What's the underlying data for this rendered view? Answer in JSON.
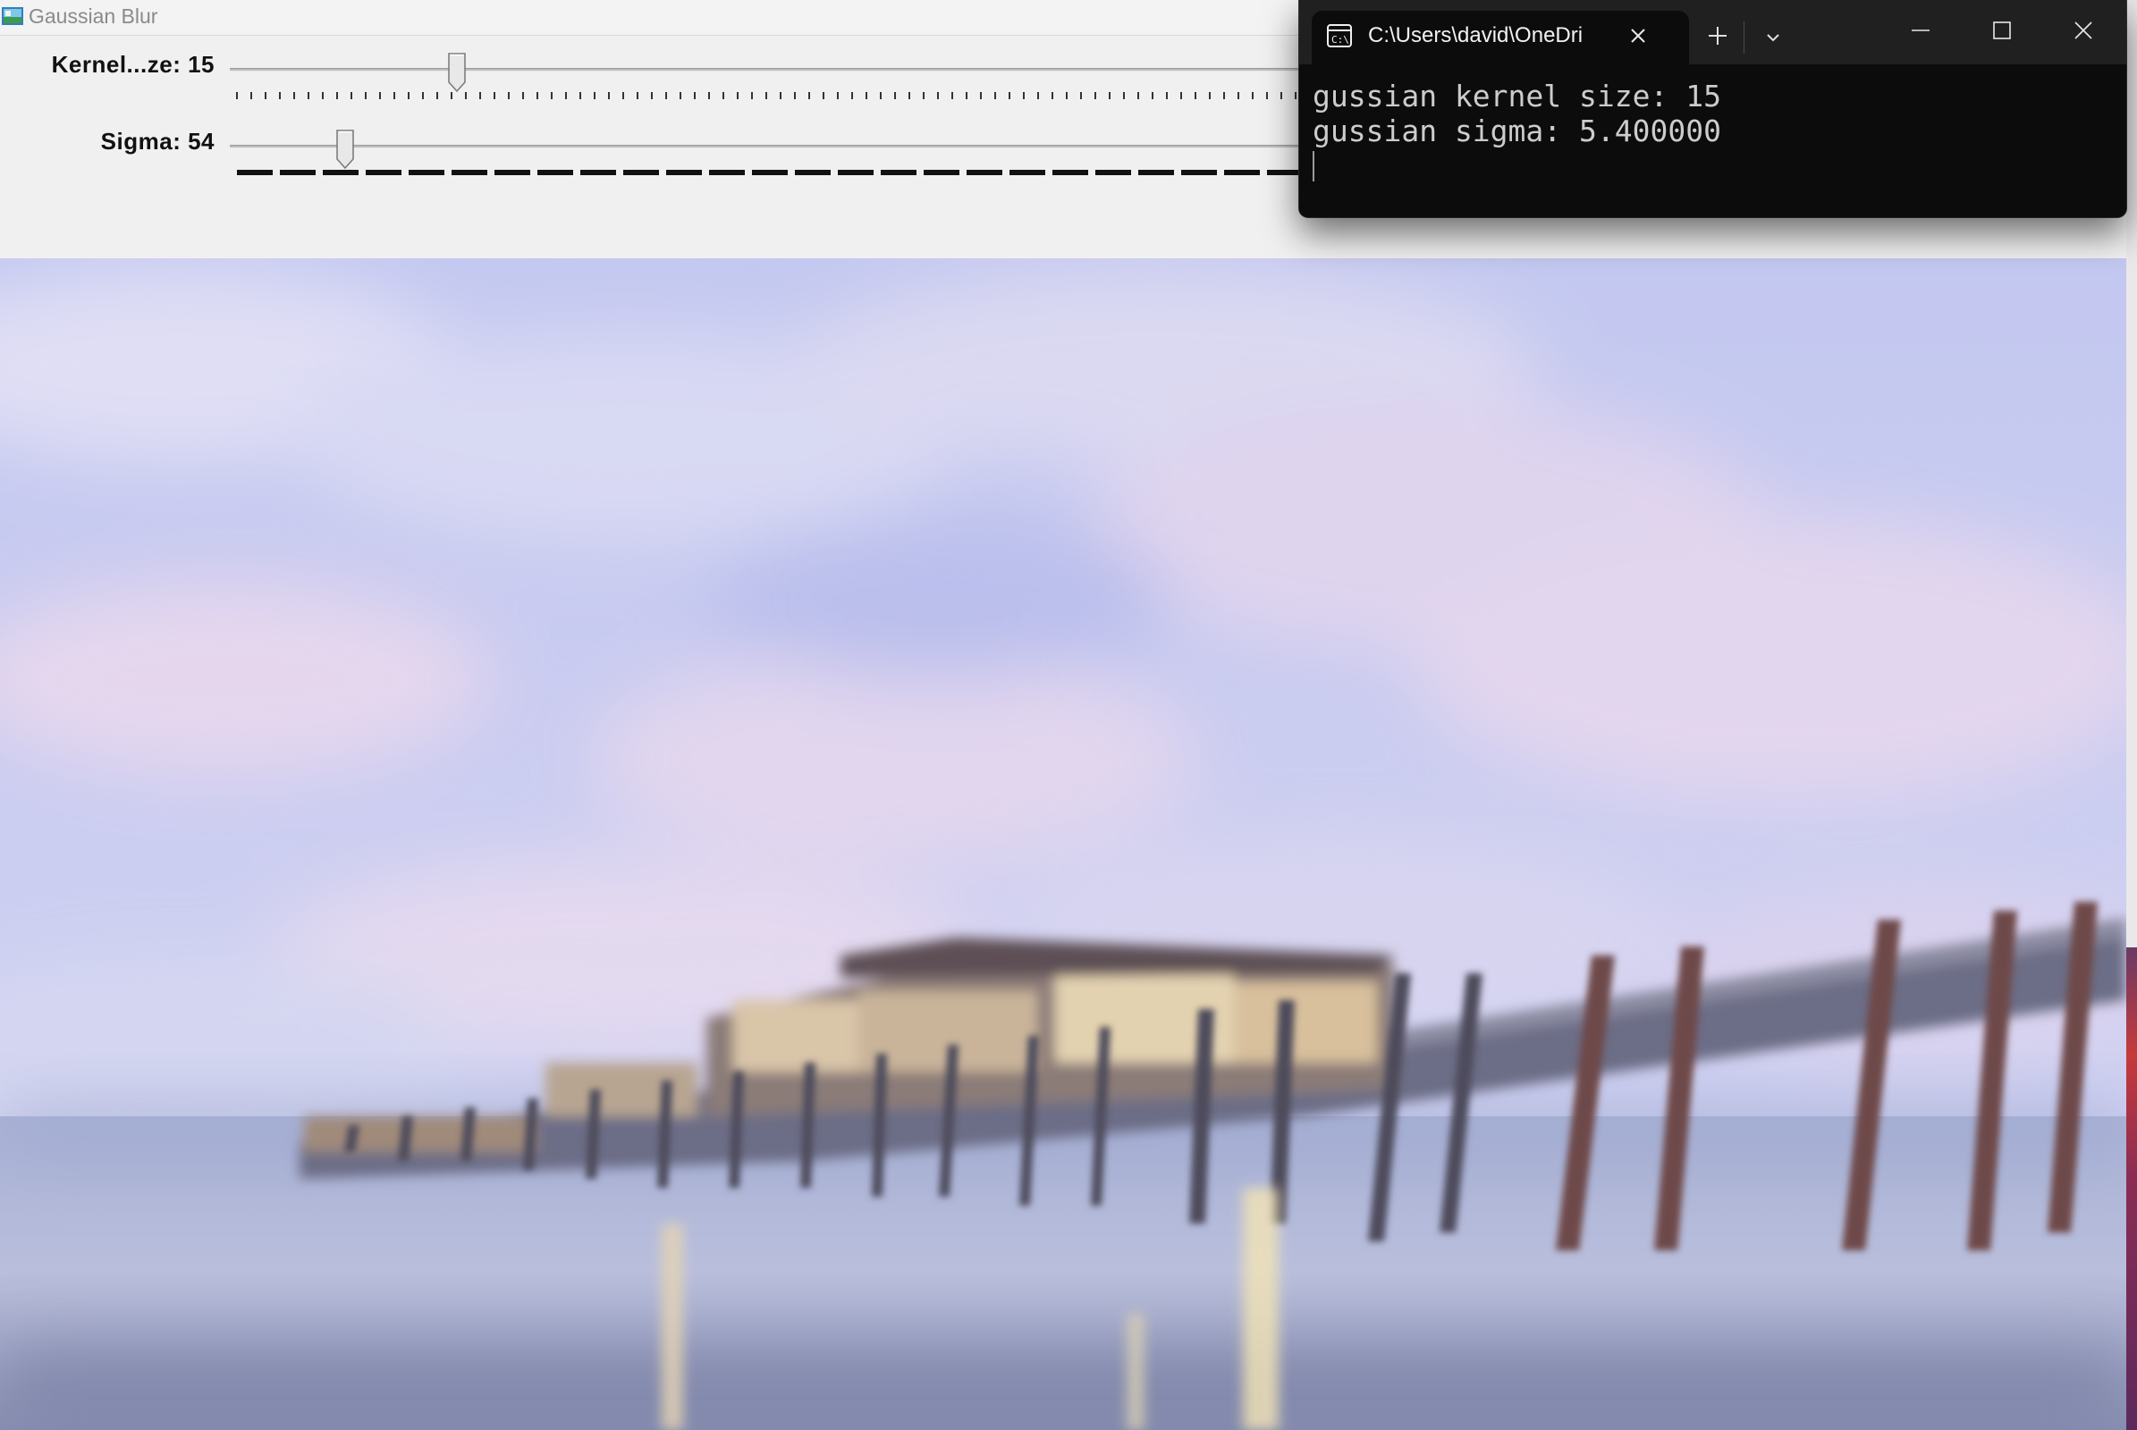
{
  "blur_window": {
    "title": "Gaussian Blur",
    "trackbars": [
      {
        "label": "Kernel...ze: 15",
        "value": 15,
        "max": 100,
        "position_fraction": 0.2
      },
      {
        "label": "Sigma: 54",
        "value": 54,
        "max": 500,
        "position_fraction": 0.1
      }
    ]
  },
  "terminal": {
    "tab_title": "C:\\Users\\david\\OneDri",
    "lines": [
      "gussian kernel size: 15",
      "gussian sigma: 5.400000"
    ]
  },
  "icons": {
    "app": "image-window-icon",
    "terminal_tab": "command-prompt-icon",
    "tab_close": "close-icon",
    "new_tab": "plus-icon",
    "dropdown": "chevron-down-icon",
    "minimize": "minimize-icon",
    "maximize": "maximize-icon",
    "close": "close-icon"
  }
}
